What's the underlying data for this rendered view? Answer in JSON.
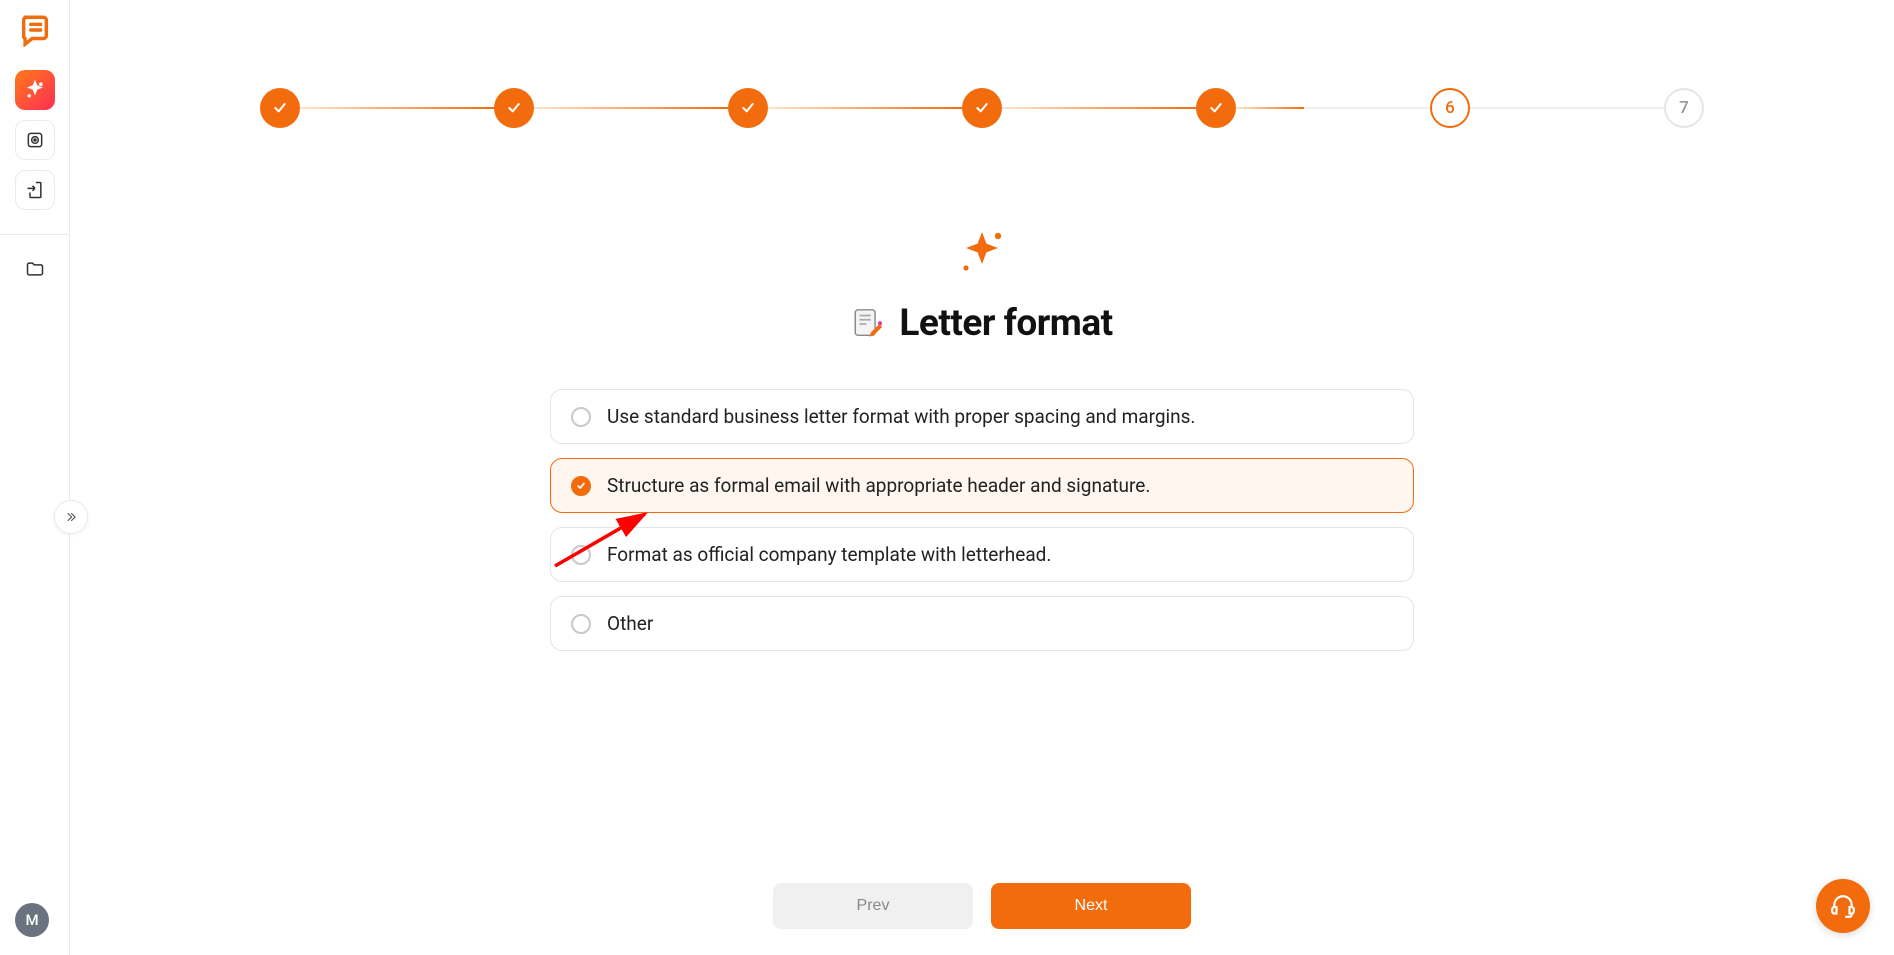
{
  "sidebar": {
    "avatar_letter": "M"
  },
  "stepper": {
    "steps": [
      {
        "state": "done"
      },
      {
        "state": "done"
      },
      {
        "state": "done"
      },
      {
        "state": "done"
      },
      {
        "state": "done"
      },
      {
        "state": "current",
        "label": "6"
      },
      {
        "state": "pending",
        "label": "7"
      }
    ]
  },
  "page": {
    "title": "Letter format"
  },
  "options": [
    {
      "label": "Use standard business letter format with proper spacing and margins.",
      "selected": false
    },
    {
      "label": "Structure as formal email with appropriate header and signature.",
      "selected": true
    },
    {
      "label": "Format as official company template with letterhead.",
      "selected": false
    },
    {
      "label": "Other",
      "selected": false
    }
  ],
  "buttons": {
    "prev": "Prev",
    "next": "Next"
  }
}
